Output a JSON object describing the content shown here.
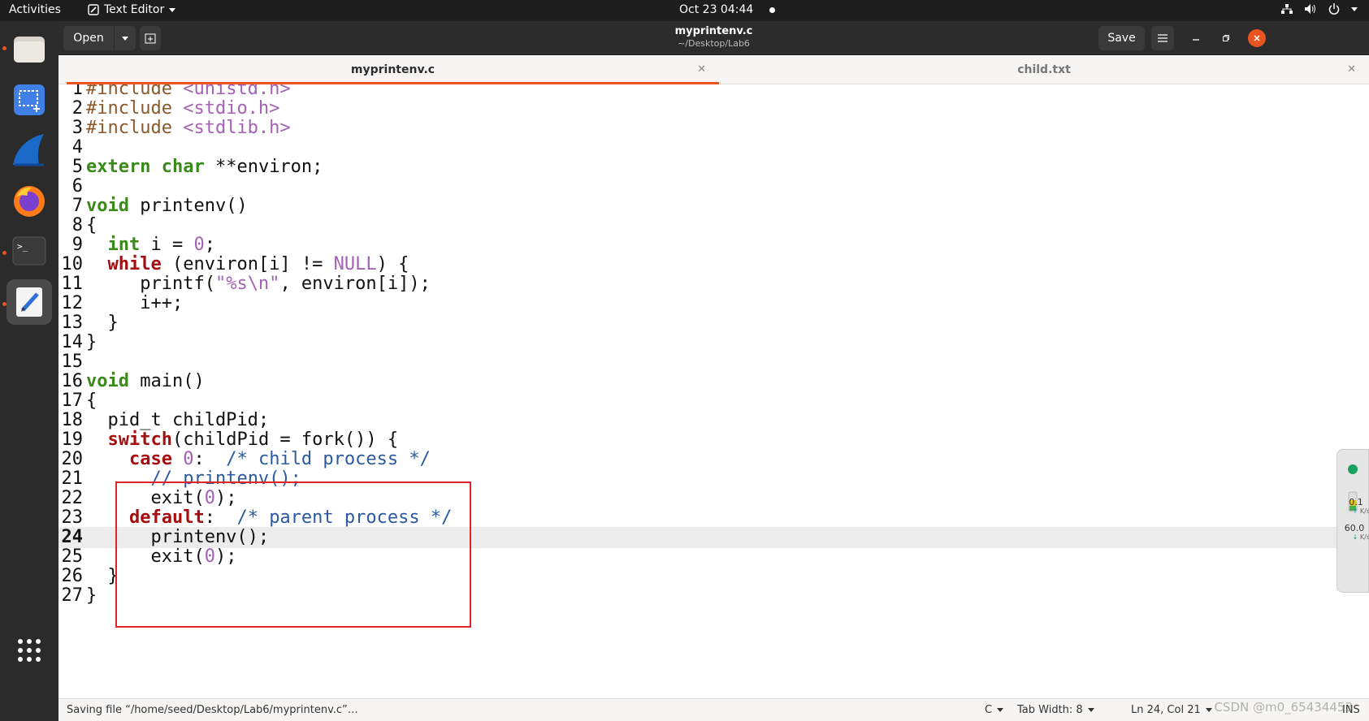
{
  "topbar": {
    "activities": "Activities",
    "app_name": "Text Editor",
    "clock": "Oct 23  04:44"
  },
  "headerbar": {
    "open_label": "Open",
    "title": "myprintenv.c",
    "subtitle": "~/Desktop/Lab6",
    "save_label": "Save"
  },
  "tabs": [
    {
      "label": "myprintenv.c",
      "active": true
    },
    {
      "label": "child.txt",
      "active": false
    }
  ],
  "editor": {
    "current_line": 24,
    "lines": [
      {
        "n": "1",
        "text": "#include <unistd.h>"
      },
      {
        "n": "2",
        "text": "#include <stdio.h>"
      },
      {
        "n": "3",
        "text": "#include <stdlib.h>"
      },
      {
        "n": "4",
        "text": ""
      },
      {
        "n": "5",
        "text": "extern char **environ;"
      },
      {
        "n": "6",
        "text": ""
      },
      {
        "n": "7",
        "text": "void printenv()"
      },
      {
        "n": "8",
        "text": "{"
      },
      {
        "n": "9",
        "text": "  int i = 0;"
      },
      {
        "n": "10",
        "text": "  while (environ[i] != NULL) {"
      },
      {
        "n": "11",
        "text": "     printf(\"%s\\n\", environ[i]);"
      },
      {
        "n": "12",
        "text": "     i++;"
      },
      {
        "n": "13",
        "text": "  }"
      },
      {
        "n": "14",
        "text": "}"
      },
      {
        "n": "15",
        "text": ""
      },
      {
        "n": "16",
        "text": "void main()"
      },
      {
        "n": "17",
        "text": "{"
      },
      {
        "n": "18",
        "text": "  pid_t childPid;"
      },
      {
        "n": "19",
        "text": "  switch(childPid = fork()) {"
      },
      {
        "n": "20",
        "text": "    case 0:  /* child process */"
      },
      {
        "n": "21",
        "text": "      // printenv();"
      },
      {
        "n": "22",
        "text": "      exit(0);"
      },
      {
        "n": "23",
        "text": "    default:  /* parent process */"
      },
      {
        "n": "24",
        "text": "      printenv();"
      },
      {
        "n": "25",
        "text": "      exit(0);"
      },
      {
        "n": "26",
        "text": "  }"
      },
      {
        "n": "27",
        "text": "}"
      }
    ]
  },
  "sidewidget": {
    "upload": "0.1",
    "upload_unit": "K/s",
    "download": "60.0",
    "download_unit": "K/s"
  },
  "statusbar": {
    "message": "Saving file “/home/seed/Desktop/Lab6/myprintenv.c”…",
    "language": "C",
    "tab_width": "Tab Width: 8",
    "position": "Ln 24, Col 21",
    "mode": "INS"
  },
  "watermark": "CSDN @m0_65434453",
  "colors": {
    "accent": "#e95420",
    "highlight_box": "#e0242a"
  }
}
